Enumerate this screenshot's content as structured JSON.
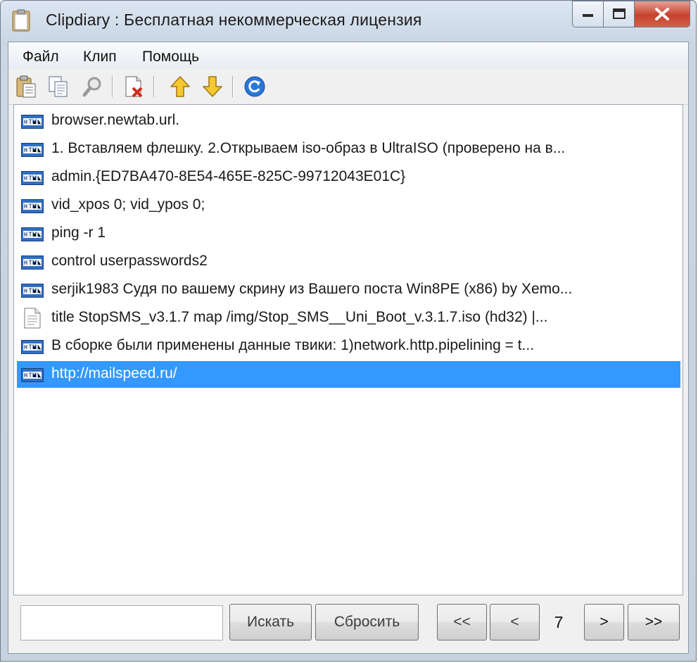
{
  "window": {
    "title": "Clipdiary : Бесплатная некоммерческая лицензия"
  },
  "menu": {
    "items": [
      "Файл",
      "Клип",
      "Помощь"
    ]
  },
  "toolbar": {
    "buttons": [
      "paste-icon",
      "copy-icon",
      "find-icon",
      "delete-icon",
      "move-up-icon",
      "move-down-icon",
      "refresh-icon"
    ]
  },
  "clips": [
    {
      "type": "html",
      "text": "browser.newtab.url."
    },
    {
      "type": "html",
      "text": "1. Вставляем флешку.  2.Открываем iso-образ в UltraISO (проверено на в..."
    },
    {
      "type": "html",
      "text": "admin.{ED7BA470-8E54-465E-825C-99712043E01C}"
    },
    {
      "type": "html",
      "text": "vid_xpos 0; vid_ypos 0;"
    },
    {
      "type": "html",
      "text": "ping -r 1"
    },
    {
      "type": "html",
      "text": "control userpasswords2"
    },
    {
      "type": "html",
      "text": "serjik1983  Судя по вашему скрину из Вашего поста Win8PE (x86) by Xemo..."
    },
    {
      "type": "text",
      "text": "title StopSMS_v3.1.7  map /img/Stop_SMS__Uni_Boot_v.3.1.7.iso (hd32) |..."
    },
    {
      "type": "html",
      "text": "В сборке были применены данные твики:    1)network.http.pipelining = t..."
    },
    {
      "type": "html",
      "text": "http://mailspeed.ru/",
      "selected": true
    }
  ],
  "search": {
    "value": "",
    "search_label": "Искать",
    "reset_label": "Сбросить"
  },
  "pager": {
    "first_label": "<<",
    "prev_label": "<",
    "page": "7",
    "next_label": ">",
    "last_label": ">>"
  },
  "colors": {
    "selection": "#3399ff",
    "close_button": "#c7422c"
  }
}
